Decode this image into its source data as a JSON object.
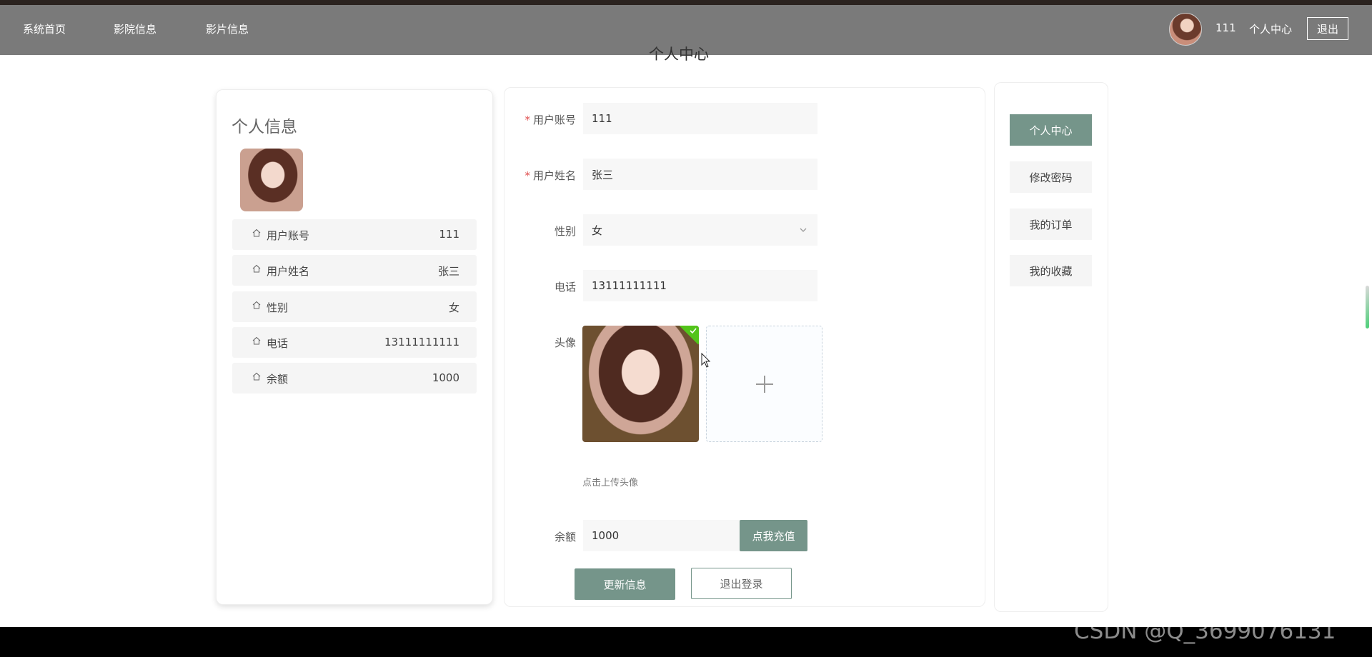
{
  "nav": {
    "items": [
      "系统首页",
      "影院信息",
      "影片信息"
    ],
    "username": "111",
    "personal_center": "个人中心",
    "logout": "退出"
  },
  "page_title": "个人中心",
  "profile_card": {
    "title": "个人信息",
    "rows": [
      {
        "label": "用户账号",
        "value": "111"
      },
      {
        "label": "用户姓名",
        "value": "张三"
      },
      {
        "label": "性别",
        "value": "女"
      },
      {
        "label": "电话",
        "value": "13111111111"
      },
      {
        "label": "余额",
        "value": "1000"
      }
    ]
  },
  "form": {
    "account": {
      "label": "用户账号",
      "value": "111"
    },
    "name": {
      "label": "用户姓名",
      "value": "张三"
    },
    "gender": {
      "label": "性别",
      "value": "女"
    },
    "phone": {
      "label": "电话",
      "value": "13111111111"
    },
    "avatar": {
      "label": "头像",
      "hint": "点击上传头像"
    },
    "balance": {
      "label": "余额",
      "value": "1000",
      "recharge": "点我充值"
    },
    "update_button": "更新信息",
    "logout_button": "退出登录"
  },
  "side_menu": [
    {
      "label": "个人中心",
      "active": true
    },
    {
      "label": "修改密码",
      "active": false
    },
    {
      "label": "我的订单",
      "active": false
    },
    {
      "label": "我的收藏",
      "active": false
    }
  ],
  "watermark": "CSDN @Q_3699076131",
  "colors": {
    "accent": "#75958a",
    "topbar": "#7a7a7a",
    "success": "#52c41a"
  }
}
